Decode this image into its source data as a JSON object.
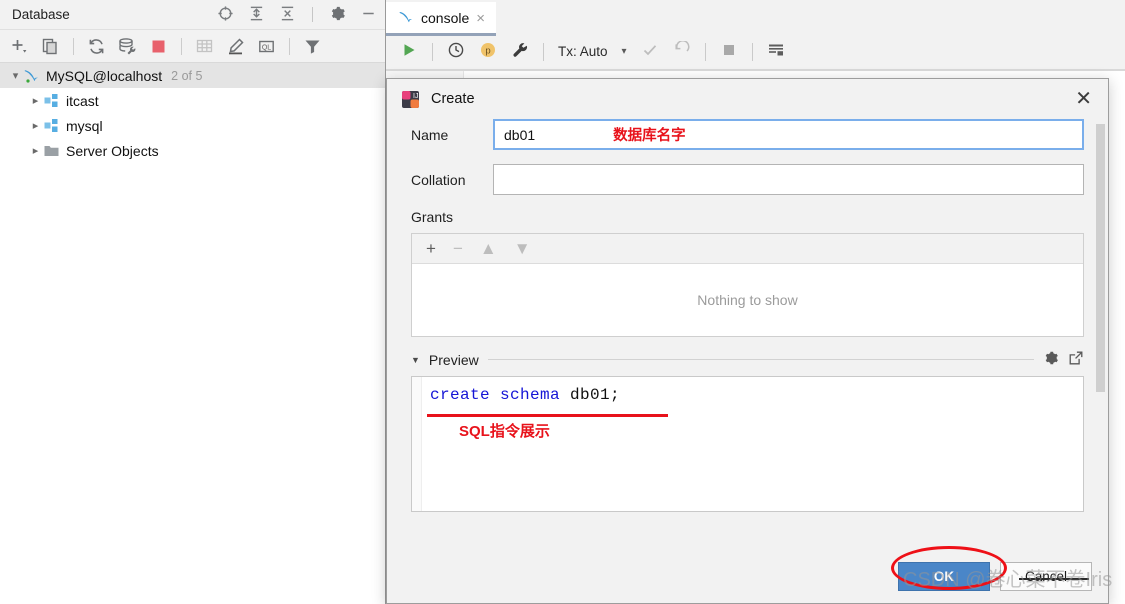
{
  "database_panel": {
    "title": "Database",
    "header_icons": [
      {
        "name": "locate-target-icon",
        "glyph": "locate"
      },
      {
        "name": "expand-all-icon",
        "glyph": "expand"
      },
      {
        "name": "collapse-all-icon",
        "glyph": "collapse"
      },
      {
        "name": "settings-gear-icon",
        "glyph": "gear"
      },
      {
        "name": "minimize-icon",
        "glyph": "minus"
      }
    ],
    "toolbar_icons": [
      {
        "name": "add-new-icon",
        "glyph": "plus-dropdown"
      },
      {
        "name": "duplicate-icon",
        "glyph": "copy"
      },
      {
        "name": "refresh-icon",
        "glyph": "refresh"
      },
      {
        "name": "data-source-properties-icon",
        "glyph": "db-wrench"
      },
      {
        "name": "stop-icon",
        "glyph": "stop-square"
      },
      {
        "name": "table-editor-icon",
        "glyph": "grid"
      },
      {
        "name": "modify-icon",
        "glyph": "pencil"
      },
      {
        "name": "query-console-icon",
        "glyph": "ql"
      },
      {
        "name": "filter-icon",
        "glyph": "funnel"
      }
    ],
    "tree": {
      "root": {
        "label": "MySQL@localhost",
        "count_badge": "2 of 5",
        "expanded": true
      },
      "children": [
        {
          "label": "itcast",
          "type": "schema",
          "expanded": false
        },
        {
          "label": "mysql",
          "type": "schema",
          "expanded": false
        },
        {
          "label": "Server Objects",
          "type": "folder",
          "expanded": false
        }
      ]
    }
  },
  "editor": {
    "tab": {
      "label": "console",
      "close_label": "×"
    },
    "run_toolbar": {
      "run_label": "run",
      "tx_label": "Tx: Auto",
      "chevron": "▾",
      "icons": [
        {
          "name": "execute-run-icon"
        },
        {
          "name": "history-clock-icon"
        },
        {
          "name": "parameters-icon",
          "glyph": "p"
        },
        {
          "name": "wrench-settings-icon"
        },
        {
          "name": "commit-check-icon"
        },
        {
          "name": "rollback-icon"
        },
        {
          "name": "stop-icon"
        },
        {
          "name": "output-panel-icon"
        }
      ]
    }
  },
  "dialog": {
    "title": "Create",
    "close_label": "✕",
    "name_field": {
      "label": "Name",
      "value": "db01",
      "placeholder": ""
    },
    "collation_field": {
      "label": "Collation",
      "value": "",
      "placeholder": ""
    },
    "grants": {
      "label": "Grants",
      "toolbar": [
        {
          "name": "add-grant-icon",
          "glyph": "+",
          "enabled": true
        },
        {
          "name": "remove-grant-icon",
          "glyph": "−",
          "enabled": false
        },
        {
          "name": "move-up-icon",
          "glyph": "▲",
          "enabled": false
        },
        {
          "name": "move-down-icon",
          "glyph": "▼",
          "enabled": false
        }
      ],
      "empty_text": "Nothing to show"
    },
    "preview": {
      "label": "Preview",
      "caret": "▼",
      "sql_keyword": "create schema",
      "sql_identifier": " db01;",
      "icons": [
        {
          "name": "preview-settings-gear-icon"
        },
        {
          "name": "open-in-editor-icon"
        }
      ]
    },
    "buttons": {
      "ok": "OK",
      "cancel": "Cancel"
    }
  },
  "annotations": {
    "name_note": "数据库名字",
    "sql_note": "SQL指令展示",
    "watermark": "CSDN @卷心菜不卷Iris"
  },
  "colors": {
    "ok_button": "#4a86c8",
    "annotation_red": "#e8121b",
    "sql_keyword_blue": "#1515d6",
    "tab_underline": "#93a2b8",
    "focus_border": "#7aaeeb"
  }
}
